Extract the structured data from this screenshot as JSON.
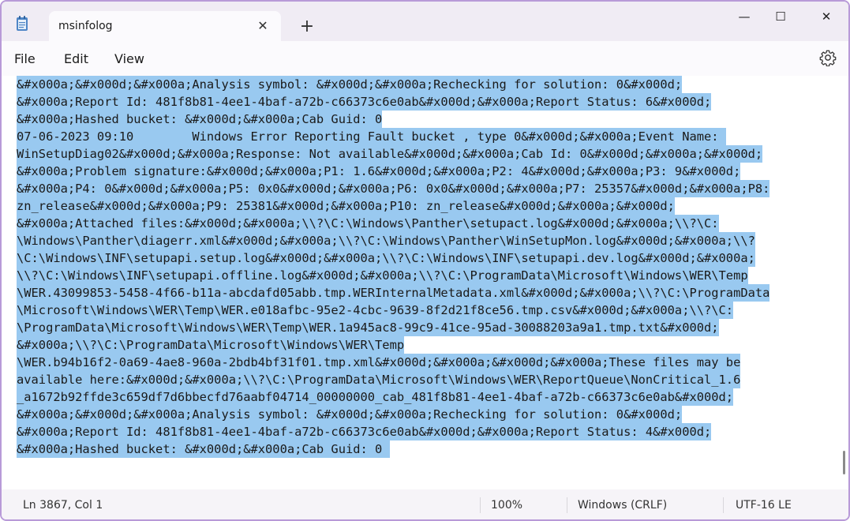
{
  "window": {
    "tab_title": "msinfolog",
    "tab_close": "✕",
    "new_tab": "+",
    "minimize": "—",
    "maximize": "☐",
    "close": "✕"
  },
  "menu": {
    "file": "File",
    "edit": "Edit",
    "view": "View"
  },
  "editor": {
    "lines": [
      "&#x000a;&#x000d;&#x000a;Analysis symbol: &#x000d;&#x000a;Rechecking for solution: 0&#x000d;",
      "&#x000a;Report Id: 481f8b81-4ee1-4baf-a72b-c66373c6e0ab&#x000d;&#x000a;Report Status: 6&#x000d;",
      "&#x000a;Hashed bucket: &#x000d;&#x000a;Cab Guid: 0",
      "07-06-2023 09:10        Windows Error Reporting Fault bucket , type 0&#x000d;&#x000a;Event Name: ",
      "WinSetupDiag02&#x000d;&#x000a;Response: Not available&#x000d;&#x000a;Cab Id: 0&#x000d;&#x000a;&#x000d;",
      "&#x000a;Problem signature:&#x000d;&#x000a;P1: 1.6&#x000d;&#x000a;P2: 4&#x000d;&#x000a;P3: 9&#x000d;",
      "&#x000a;P4: 0&#x000d;&#x000a;P5: 0x0&#x000d;&#x000a;P6: 0x0&#x000d;&#x000a;P7: 25357&#x000d;&#x000a;P8:",
      "zn_release&#x000d;&#x000a;P9: 25381&#x000d;&#x000a;P10: zn_release&#x000d;&#x000a;&#x000d;",
      "&#x000a;Attached files:&#x000d;&#x000a;\\\\?\\C:\\Windows\\Panther\\setupact.log&#x000d;&#x000a;\\\\?\\C:",
      "\\Windows\\Panther\\diagerr.xml&#x000d;&#x000a;\\\\?\\C:\\Windows\\Panther\\WinSetupMon.log&#x000d;&#x000a;\\\\?",
      "\\C:\\Windows\\INF\\setupapi.setup.log&#x000d;&#x000a;\\\\?\\C:\\Windows\\INF\\setupapi.dev.log&#x000d;&#x000a;",
      "\\\\?\\C:\\Windows\\INF\\setupapi.offline.log&#x000d;&#x000a;\\\\?\\C:\\ProgramData\\Microsoft\\Windows\\WER\\Temp",
      "\\WER.43099853-5458-4f66-b11a-abcdafd05abb.tmp.WERInternalMetadata.xml&#x000d;&#x000a;\\\\?\\C:\\ProgramData",
      "\\Microsoft\\Windows\\WER\\Temp\\WER.e018afbc-95e2-4cbc-9639-8f2d21f8ce56.tmp.csv&#x000d;&#x000a;\\\\?\\C:",
      "\\ProgramData\\Microsoft\\Windows\\WER\\Temp\\WER.1a945ac8-99c9-41ce-95ad-30088203a9a1.tmp.txt&#x000d;",
      "&#x000a;\\\\?\\C:\\ProgramData\\Microsoft\\Windows\\WER\\Temp",
      "\\WER.b94b16f2-0a69-4ae8-960a-2bdb4bf31f01.tmp.xml&#x000d;&#x000a;&#x000d;&#x000a;These files may be",
      "available here:&#x000d;&#x000a;\\\\?\\C:\\ProgramData\\Microsoft\\Windows\\WER\\ReportQueue\\NonCritical_1.6",
      "_a1672b92ffde3c659df7d6bbecfd76aabf04714_00000000_cab_481f8b81-4ee1-4baf-a72b-c66373c6e0ab&#x000d;",
      "&#x000a;&#x000d;&#x000a;Analysis symbol: &#x000d;&#x000a;Rechecking for solution: 0&#x000d;",
      "&#x000a;Report Id: 481f8b81-4ee1-4baf-a72b-c66373c6e0ab&#x000d;&#x000a;Report Status: 4&#x000d;",
      "&#x000a;Hashed bucket: &#x000d;&#x000a;Cab Guid: 0 "
    ],
    "selection_color": "#99c9f0"
  },
  "status": {
    "position": "Ln 3867, Col 1",
    "zoom": "100%",
    "line_ending": "Windows (CRLF)",
    "encoding": "UTF-16 LE"
  },
  "icons": {
    "app": "notepad-icon",
    "settings": "gear-icon"
  }
}
